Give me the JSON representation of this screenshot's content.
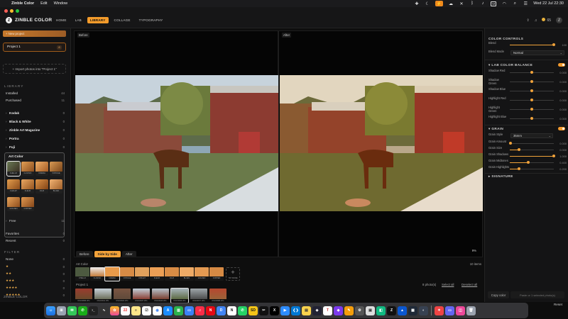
{
  "menubar": {
    "app_name": "Zinble Color",
    "menus": [
      "Edit",
      "Window"
    ],
    "battery": "VI",
    "datetime": "Wed 22 Jul  22:30"
  },
  "header": {
    "logo_text": "ZINBLE COLOR",
    "tabs": [
      "HOME",
      "LAB",
      "LIBRARY",
      "COLLAGE",
      "TYPOGRAPHY"
    ],
    "active_tab": "LIBRARY",
    "credits": "65",
    "avatar_initial": "Z"
  },
  "sidebar": {
    "new_project_label": "+ New project",
    "project_name": "Project 1",
    "project_count": "8",
    "import_label": "+ Import photos into \"Project 1\"",
    "library_title": "LIBRARY",
    "installed": {
      "label": "Installed",
      "count": "44"
    },
    "purchased": {
      "label": "Purchased",
      "count": "11"
    },
    "groups": [
      {
        "label": "Kodak",
        "count": "0"
      },
      {
        "label": "Black & White",
        "count": "0"
      },
      {
        "label": "Zinble Art Magazine",
        "count": "0"
      },
      {
        "label": "Portra",
        "count": "0"
      },
      {
        "label": "Fuji",
        "count": "0"
      }
    ],
    "art_color_label": "Art Color",
    "art_color_items": [
      "CHELLO",
      "CLASSIC",
      "CINEMA",
      "VINTAGE",
      "CHALET",
      "FLEUR",
      "FILM",
      "BLUES",
      "GOLDEN",
      "COPPER"
    ],
    "free": {
      "label": "Free",
      "count": "11"
    },
    "favorites": {
      "label": "Favorites",
      "count": "0"
    },
    "recent": {
      "label": "Recent",
      "count": "0"
    },
    "filter_title": "FILTER",
    "ratings": [
      {
        "label": "None",
        "count": "0"
      },
      {
        "label": "★",
        "count": "0"
      },
      {
        "label": "★★",
        "count": "0"
      },
      {
        "label": "★★★",
        "count": "0"
      },
      {
        "label": "★★★★",
        "count": "0"
      },
      {
        "label": "★★★★★",
        "count": "0"
      }
    ],
    "footer": "ZINBLE COLOR"
  },
  "viewer": {
    "before_label": "Before",
    "after_label": "After",
    "compare_modes": [
      "Before",
      "Side by Side",
      "After"
    ],
    "active_mode": "Side by Side",
    "zoom": "9%"
  },
  "presets_strip": {
    "title": "Art Color",
    "count": "10 items",
    "items": [
      "CHELLO",
      "CLASSIC",
      "CINEMA",
      "VINTAGE",
      "CHALET",
      "FLEUR",
      "FILM",
      "BLUES",
      "GOLDEN",
      "COPPER"
    ],
    "add_label": "TRY MORE"
  },
  "project_strip": {
    "title": "Project 1",
    "selection_info": "8 photo(s)",
    "select_all": "Select all",
    "deselect_all": "Deselect all",
    "items": [
      "DSC00896.JPG",
      "DSC00911.JPG",
      "DSC00922.JPG",
      "DSC00937.JPG",
      "DSC00945.JPG",
      "DSC00966.JPG",
      "DSC00977.JPG",
      "DSC00986.JPG"
    ]
  },
  "controls": {
    "color_controls_title": "COLOR CONTROLS",
    "blend": {
      "label": "Blend",
      "value": "100"
    },
    "blend_mode": {
      "label": "Blend Mode",
      "value": "Normal"
    },
    "lab_title": "LAB COLOR BALANCE",
    "lab_rows": [
      {
        "label": "Shadow Red",
        "value": "0.000"
      },
      {
        "label": "Shadow Green",
        "value": "0.000"
      },
      {
        "label": "Shadow Blue",
        "value": "0.000"
      },
      {
        "label": "Highlight Red",
        "value": "0.000"
      },
      {
        "label": "Highlight Green",
        "value": "0.000"
      },
      {
        "label": "Highlight Blue",
        "value": "0.000"
      }
    ],
    "grain_title": "GRAIN",
    "grain_style": {
      "label": "Grain Style",
      "value": "35mm"
    },
    "grain_rows": [
      {
        "label": "Grain Amount",
        "value": "0.000"
      },
      {
        "label": "Grain Size",
        "value": "0.000"
      },
      {
        "label": "Grain Shadows",
        "value": "1.000"
      },
      {
        "label": "Grain Midtones",
        "value": "0.400"
      },
      {
        "label": "Grain Highlights",
        "value": "0.200"
      }
    ],
    "signature_title": "SIGNATURE",
    "copy_label": "Copy color",
    "paste_label": "Paste or 1 selected photo(s)",
    "reset_label": "Reset"
  },
  "dock": {
    "apps": [
      "finder-app",
      "launchpad-app",
      "messages-app",
      "wechat-app",
      "terminal-app",
      "activity-app",
      "photos-app",
      "calendar-app",
      "notes-app",
      "reminders-app",
      "chrome-app",
      "appstore-app",
      "numbers-app",
      "keynote-app",
      "music-app",
      "netflix-app",
      "docs-app",
      "notion-app",
      "whatsapp-app",
      "sd-app",
      "capcut-app",
      "x-app",
      "zoom-app",
      "vscode-app",
      "stickies-app",
      "davinci-app",
      "typora-app",
      "obsidian-app",
      "pages-app",
      "settings-app",
      "preview-app",
      "onlyoffice-app",
      "zinble-app",
      "drive-app",
      "vm-app",
      "blender-app",
      "sketch-app",
      "screen-app",
      "trash-app"
    ]
  }
}
